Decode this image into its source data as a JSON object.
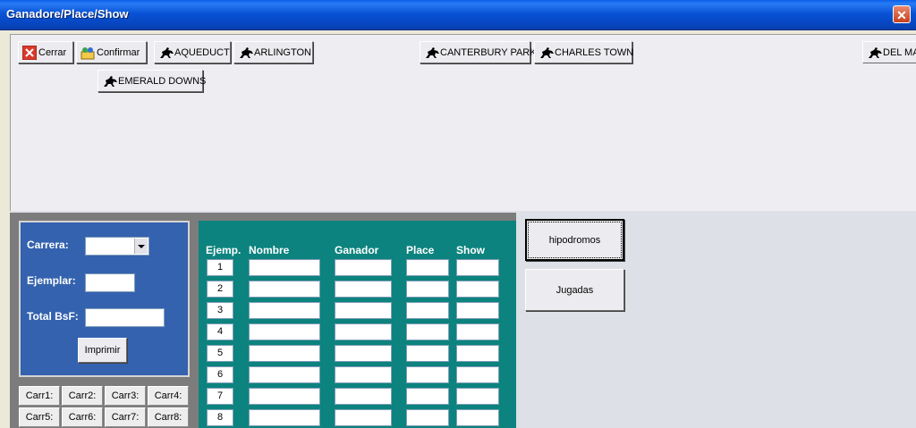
{
  "window": {
    "title": "Ganadore/Place/Show",
    "close_glyph": "✕"
  },
  "toolbar": {
    "buttons": [
      {
        "label": "Cerrar",
        "icon": "close-x-icon"
      },
      {
        "label": "Confirmar",
        "icon": "confirm-people-icon"
      },
      {
        "label": "AQUEDUCT",
        "icon": "horse-rider-icon"
      },
      {
        "label": "ARLINGTON",
        "icon": "horse-rider-icon"
      },
      {
        "label": "CANTERBURY PARK",
        "icon": "horse-rider-icon"
      },
      {
        "label": "CHARLES TOWN",
        "icon": "horse-rider-icon"
      },
      {
        "label": "DEL MA",
        "icon": "horse-rider-icon"
      },
      {
        "label": "EMERALD DOWNS",
        "icon": "horse-rider-icon"
      }
    ]
  },
  "form": {
    "carrera_label": "Carrera:",
    "ejemplar_label": "Ejemplar:",
    "total_label": "Total BsF:",
    "print_label": "Imprimir",
    "carrera_value": "",
    "ejemplar_value": "",
    "total_value": ""
  },
  "races": [
    "Carr1:",
    "Carr2:",
    "Carr3:",
    "Carr4:",
    "Carr5:",
    "Carr6:",
    "Carr7:",
    "Carr8:"
  ],
  "grid": {
    "headers": [
      "Ejemp.",
      "Nombre",
      "Ganador",
      "Place",
      "Show"
    ],
    "rows": [
      "1",
      "2",
      "3",
      "4",
      "5",
      "6",
      "7",
      "8"
    ]
  },
  "side": {
    "hipodromos": "hipodromos",
    "jugadas": "Jugadas"
  },
  "colors": {
    "form_blue": "#3462AE",
    "grid_teal": "#0C837E",
    "titlebar_blue": "#0853D6"
  }
}
